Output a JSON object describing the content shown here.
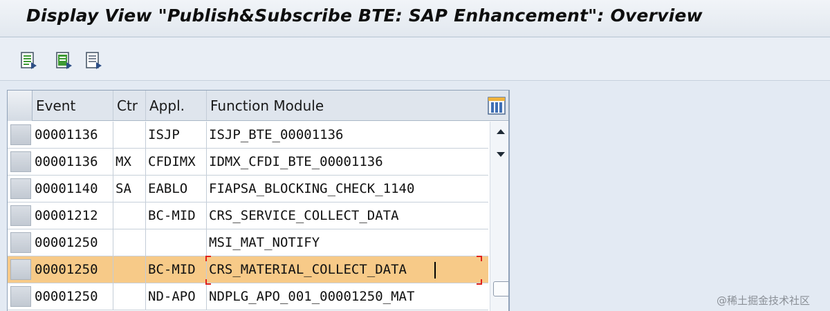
{
  "window": {
    "title": "Display View \"Publish&Subscribe BTE: SAP Enhancement\": Overview"
  },
  "toolbar": {
    "buttons": [
      {
        "name": "details-icon"
      },
      {
        "name": "select-all-icon"
      },
      {
        "name": "select-block-icon"
      }
    ]
  },
  "table": {
    "columns": [
      "Event",
      "Ctr",
      "Appl.",
      "Function Module"
    ],
    "rows": [
      {
        "event": "00001136",
        "ctr": "",
        "appl": "ISJP",
        "fm": "ISJP_BTE_00001136",
        "highlighted": false
      },
      {
        "event": "00001136",
        "ctr": "MX",
        "appl": "CFDIMX",
        "fm": "IDMX_CFDI_BTE_00001136",
        "highlighted": false
      },
      {
        "event": "00001140",
        "ctr": "SA",
        "appl": "EABLO",
        "fm": "FIAPSA_BLOCKING_CHECK_1140",
        "highlighted": false
      },
      {
        "event": "00001212",
        "ctr": "",
        "appl": "BC-MID",
        "fm": "CRS_SERVICE_COLLECT_DATA",
        "highlighted": false
      },
      {
        "event": "00001250",
        "ctr": "",
        "appl": "",
        "fm": "MSI_MAT_NOTIFY",
        "highlighted": false
      },
      {
        "event": "00001250",
        "ctr": "",
        "appl": "BC-MID",
        "fm": "CRS_MATERIAL_COLLECT_DATA",
        "highlighted": true
      },
      {
        "event": "00001250",
        "ctr": "",
        "appl": "ND-APO",
        "fm": "NDPLG_APO_001_00001250_MAT",
        "highlighted": false
      }
    ]
  },
  "colors": {
    "highlight_row": "#f7ca88",
    "focus_marker": "#e0221b"
  },
  "watermark": "@稀土掘金技术社区"
}
